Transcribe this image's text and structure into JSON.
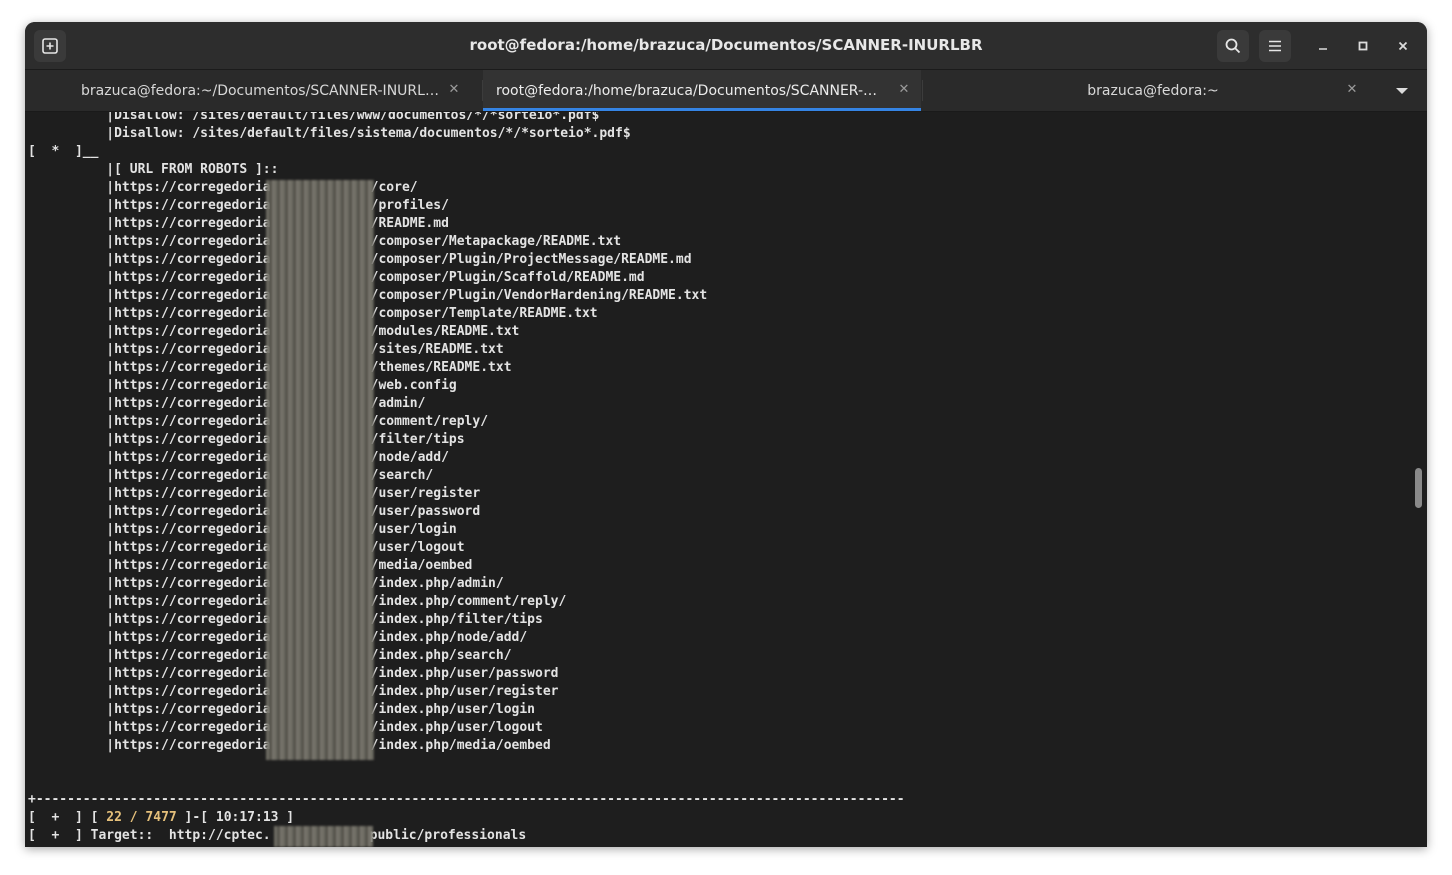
{
  "window": {
    "title": "root@fedora:/home/brazuca/Documentos/SCANNER-INURLBR"
  },
  "tabs": [
    {
      "label": "brazuca@fedora:~/Documentos/SCANNER-INURLBR",
      "active": false
    },
    {
      "label": "root@fedora:/home/brazuca/Documentos/SCANNER-IN…",
      "active": true
    },
    {
      "label": "brazuca@fedora:~",
      "active": false
    }
  ],
  "icons": {
    "new_tab": "new-tab-icon",
    "search": "search-icon",
    "menu": "hamburger-menu-icon",
    "minimize": "minimize-icon",
    "maximize": "maximize-icon",
    "close": "close-icon",
    "tab_close": "close-icon",
    "tab_list": "chevron-down-icon"
  },
  "terminal": {
    "lines_top": [
      "          |Disallow: /sites/default/files/www/documentos/*/*sorteio*.pdf$",
      "          |Disallow: /sites/default/files/sistema/documentos/*/*sorteio*.pdf$",
      "[  *  ]__",
      "          |[ URL FROM ROBOTS ]::"
    ],
    "url_prefix": "          |https://corregedoria",
    "url_paths": [
      "/core/",
      "/profiles/",
      "/README.md",
      "/composer/Metapackage/README.txt",
      "/composer/Plugin/ProjectMessage/README.md",
      "/composer/Plugin/Scaffold/README.md",
      "/composer/Plugin/VendorHardening/README.txt",
      "/composer/Template/README.txt",
      "/modules/README.txt",
      "/sites/README.txt",
      "/themes/README.txt",
      "/web.config",
      "/admin/",
      "/comment/reply/",
      "/filter/tips",
      "/node/add/",
      "/search/",
      "/user/register",
      "/user/password",
      "/user/login",
      "/user/logout",
      "/media/oembed",
      "/index.php/admin/",
      "/index.php/comment/reply/",
      "/index.php/filter/tips",
      "/index.php/node/add/",
      "/index.php/search/",
      "/index.php/user/password",
      "/index.php/user/register",
      "/index.php/user/login",
      "/index.php/user/logout",
      "/index.php/media/oembed"
    ],
    "separator": "+---------------------------------------------------------------------------------------------------------------",
    "status_prefix": "[  +  ] [ ",
    "status_count": "22 / 7477",
    "status_suffix": " ]-[ 10:17:13 ]",
    "target_prefix": "[  +  ] Target::  http://cptec.",
    "target_suffix": "public/professionals"
  },
  "colors": {
    "terminal_bg": "#1e1e1e",
    "text": "#e3e3e3",
    "highlight": "#e5c07b",
    "accent": "#3584e4"
  }
}
